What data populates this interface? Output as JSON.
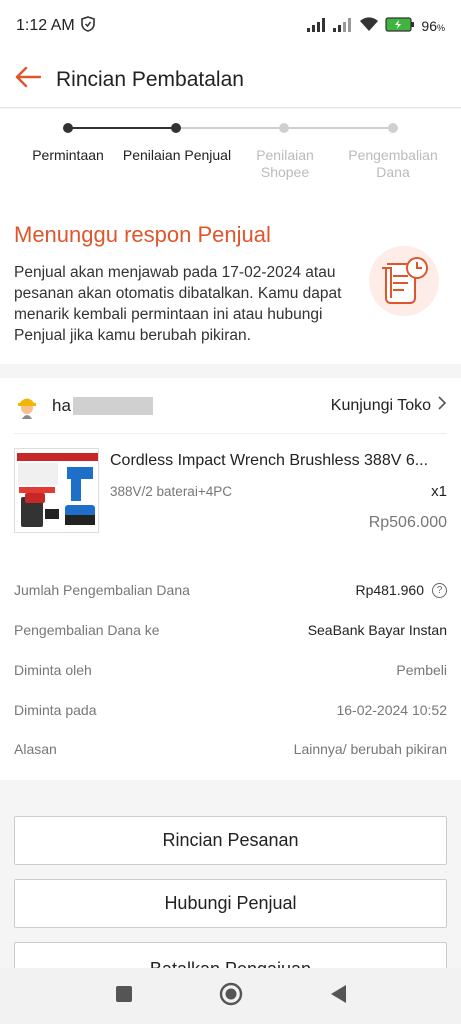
{
  "status_bar": {
    "time": "1:12 AM",
    "battery": "96",
    "battery_unit": "%"
  },
  "header": {
    "title": "Rincian Pembatalan"
  },
  "stepper": {
    "steps": [
      {
        "label": "Permintaan",
        "state": "done"
      },
      {
        "label": "Penilaian Penjual",
        "state": "current"
      },
      {
        "label": "Penilaian Shopee",
        "state": "pending"
      },
      {
        "label": "Pengembalian Dana",
        "state": "pending"
      }
    ],
    "active_color": "#333333",
    "inactive_color": "#cfcfcf"
  },
  "status": {
    "heading": "Menunggu respon Penjual",
    "description": "Penjual akan menjawab pada 17-02-2024 atau pesanan akan otomatis dibatalkan. Kamu dapat menarik kembali permintaan ini atau hubungi Penjual jika kamu berubah pikiran.",
    "accent": "#e0562c"
  },
  "shop": {
    "name_prefix": "ha",
    "visit_label": "Kunjungi Toko"
  },
  "product": {
    "name": "Cordless Impact Wrench Brushless 388V 6...",
    "variant": "388V/2 baterai+4PC",
    "qty": "x1",
    "price": "Rp506.000"
  },
  "details": [
    {
      "label": "Jumlah Pengembalian Dana",
      "value": "Rp481.960"
    },
    {
      "label": "Pengembalian Dana ke",
      "value": "SeaBank Bayar Instan"
    },
    {
      "label": "Diminta oleh",
      "value": "Pembeli"
    },
    {
      "label": "Diminta pada",
      "value": "16-02-2024 10:52"
    },
    {
      "label": "Alasan",
      "value": "Lainnya/ berubah pikiran"
    }
  ],
  "buttons": {
    "order_details": "Rincian Pesanan",
    "contact_seller": "Hubungi Penjual",
    "cancel_request": "Batalkan Pengajuan"
  },
  "icons": {
    "back": "back-arrow-icon",
    "clock": "alarm-clock-icon",
    "wifi": "wifi-icon",
    "signal": "signal-icon",
    "battery": "battery-icon",
    "help": "help-circle-icon",
    "chevron": "chevron-right-icon"
  }
}
